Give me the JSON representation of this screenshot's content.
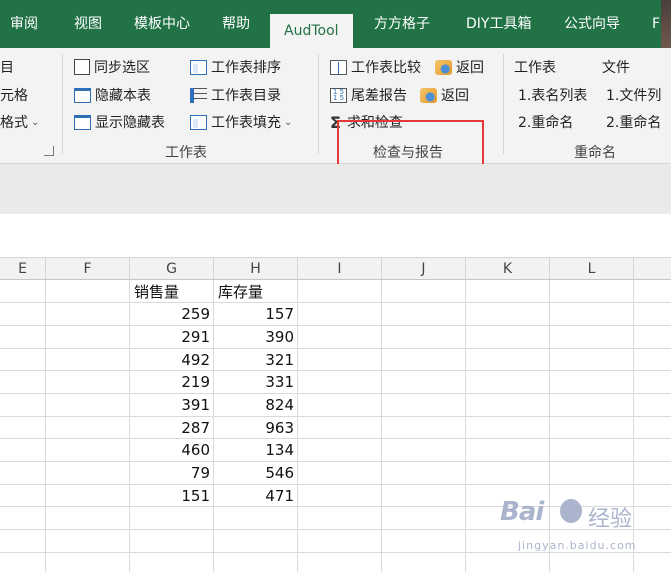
{
  "tabs": [
    {
      "label": "审阅",
      "active": false
    },
    {
      "label": "视图",
      "active": false
    },
    {
      "label": "模板中心",
      "active": false
    },
    {
      "label": "帮助",
      "active": false
    },
    {
      "label": "AudTool",
      "active": true
    },
    {
      "label": "方方格子",
      "active": false
    },
    {
      "label": "DIY工具箱",
      "active": false
    },
    {
      "label": "公式向导",
      "active": false
    },
    {
      "label": "F",
      "active": false
    }
  ],
  "ribbon": {
    "left_partial": [
      "目",
      "元格",
      "格式"
    ],
    "worksheet_group": {
      "label": "工作表",
      "col1": [
        "同步选区",
        "隐藏本表",
        "显示隐藏表"
      ],
      "col2": [
        "工作表排序",
        "工作表目录",
        "工作表填充"
      ]
    },
    "check_group": {
      "label": "检查与报告",
      "compare": "工作表比较",
      "back1": "返回",
      "tail_report": "尾差报告",
      "back2": "返回",
      "sum_check": "求和检查"
    },
    "rename_group": {
      "label": "重命名",
      "sheet_header": "工作表",
      "file_header": "文件",
      "sheet_items": [
        "1.表名列表",
        "2.重命名"
      ],
      "file_items": [
        "1.文件列",
        "2.重命名"
      ]
    }
  },
  "grid": {
    "columns": [
      "E",
      "F",
      "G",
      "H",
      "I",
      "J",
      "K",
      "L"
    ],
    "header_row": {
      "G": "销售量",
      "H": "库存量"
    },
    "rows": [
      {
        "G": "259",
        "H": "157"
      },
      {
        "G": "291",
        "H": "390"
      },
      {
        "G": "492",
        "H": "321"
      },
      {
        "G": "219",
        "H": "331"
      },
      {
        "G": "391",
        "H": "824"
      },
      {
        "G": "287",
        "H": "963"
      },
      {
        "G": "460",
        "H": "134"
      },
      {
        "G": "79",
        "H": "546"
      },
      {
        "G": "151",
        "H": "471"
      }
    ]
  },
  "watermark": {
    "brand": "Bai",
    "brand_suffix": "经验",
    "url": "jingyan.baidu.com"
  },
  "colors": {
    "tab_green": "#217346",
    "highlight_red": "#e23838"
  }
}
